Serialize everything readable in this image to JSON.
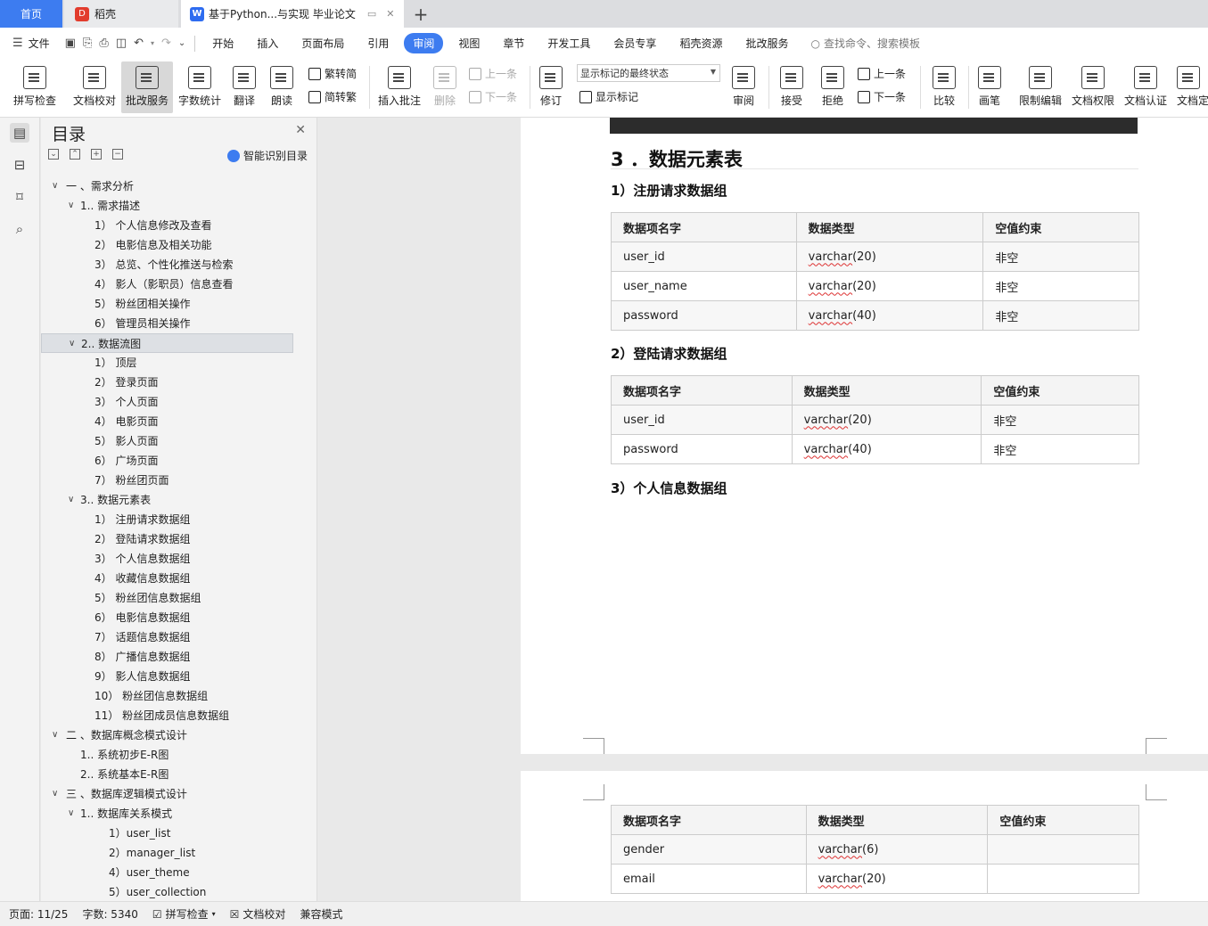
{
  "tabs": {
    "home": "首页",
    "daoke": "稻壳",
    "doc": "基于Python...与实现 毕业论文",
    "add": "+"
  },
  "menu": {
    "file": "文件",
    "items": [
      "开始",
      "插入",
      "页面布局",
      "引用",
      "审阅",
      "视图",
      "章节",
      "开发工具",
      "会员专享",
      "稻壳资源",
      "批改服务"
    ],
    "active": "审阅",
    "search": "查找命令、搜索模板"
  },
  "ribbon": {
    "spell": "拼写检查",
    "proofread": "文档校对",
    "correction": "批改服务",
    "wordcount": "字数统计",
    "translate": "翻译",
    "read": "朗读",
    "to_trad": "繁转简",
    "to_simp": "简转繁",
    "insert_comment": "插入批注",
    "delete": "删除",
    "prev": "上一条",
    "next": "下一条",
    "track": "修订",
    "markup_state": "显示标记的最终状态",
    "show_markup": "显示标记",
    "review": "审阅",
    "accept": "接受",
    "reject": "拒绝",
    "prev2": "上一条",
    "next2": "下一条",
    "compare": "比较",
    "pen": "画笔",
    "restrict": "限制编辑",
    "permission": "文档权限",
    "certify": "文档认证",
    "finalize": "文档定"
  },
  "toc": {
    "title": "目录",
    "smart": "智能识别目录",
    "items": [
      {
        "text": "一 、需求分析",
        "level": 0,
        "chev": true
      },
      {
        "text": "1.. 需求描述",
        "level": 1,
        "chev": true
      },
      {
        "text": "1） 个人信息修改及查看",
        "level": 2
      },
      {
        "text": "2） 电影信息及相关功能",
        "level": 2
      },
      {
        "text": "3） 总览、个性化推送与检索",
        "level": 2
      },
      {
        "text": "4） 影人（影职员）信息查看",
        "level": 2
      },
      {
        "text": "5） 粉丝团相关操作",
        "level": 2
      },
      {
        "text": "6） 管理员相关操作",
        "level": 2
      },
      {
        "text": "2.. 数据流图",
        "level": 1,
        "chev": true,
        "selected": true
      },
      {
        "text": "1） 顶层",
        "level": 2
      },
      {
        "text": "2） 登录页面",
        "level": 2
      },
      {
        "text": "3） 个人页面",
        "level": 2
      },
      {
        "text": "4） 电影页面",
        "level": 2
      },
      {
        "text": "5） 影人页面",
        "level": 2
      },
      {
        "text": "6） 广场页面",
        "level": 2
      },
      {
        "text": "7） 粉丝团页面",
        "level": 2
      },
      {
        "text": "3.. 数据元素表",
        "level": 1,
        "chev": true
      },
      {
        "text": "1） 注册请求数据组",
        "level": 2
      },
      {
        "text": "2） 登陆请求数据组",
        "level": 2
      },
      {
        "text": "3） 个人信息数据组",
        "level": 2
      },
      {
        "text": "4） 收藏信息数据组",
        "level": 2
      },
      {
        "text": "5） 粉丝团信息数据组",
        "level": 2
      },
      {
        "text": "6） 电影信息数据组",
        "level": 2
      },
      {
        "text": "7） 话题信息数据组",
        "level": 2
      },
      {
        "text": "8） 广播信息数据组",
        "level": 2
      },
      {
        "text": "9） 影人信息数据组",
        "level": 2
      },
      {
        "text": "10） 粉丝团信息数据组",
        "level": 2
      },
      {
        "text": "11） 粉丝团成员信息数据组",
        "level": 2
      },
      {
        "text": "二 、数据库概念模式设计",
        "level": 0,
        "chev": true
      },
      {
        "text": "1.. 系统初步E-R图",
        "level": 1
      },
      {
        "text": "2.. 系统基本E-R图",
        "level": 1
      },
      {
        "text": "三 、数据库逻辑模式设计",
        "level": 0,
        "chev": true
      },
      {
        "text": "1.. 数据库关系模式",
        "level": 1,
        "chev": true
      },
      {
        "text": "1）user_list",
        "level": 3
      },
      {
        "text": "2）manager_list",
        "level": 3
      },
      {
        "text": "4）user_theme",
        "level": 3
      },
      {
        "text": "5）user_collection",
        "level": 3
      }
    ]
  },
  "doc": {
    "section_title": "3 ．数据元素表",
    "sub1": "1）注册请求数据组",
    "sub2": "2）登陆请求数据组",
    "sub3": "3）个人信息数据组",
    "headers": [
      "数据项名字",
      "数据类型",
      "空值约束"
    ],
    "table1": [
      [
        "user_id",
        "varchar",
        "(20)",
        "非空"
      ],
      [
        "user_name",
        "varchar",
        "(20)",
        "非空"
      ],
      [
        "password",
        "varchar",
        "(40)",
        "非空"
      ]
    ],
    "table2": [
      [
        "user_id",
        "varchar",
        "(20)",
        "非空"
      ],
      [
        "password",
        "varchar",
        "(40)",
        "非空"
      ]
    ],
    "table3": [
      [
        "gender",
        "varchar",
        "(6)",
        ""
      ],
      [
        "email",
        "varchar",
        "(20)",
        ""
      ]
    ]
  },
  "status": {
    "page": "页面: 11/25",
    "words": "字数: 5340",
    "spell": "拼写检查",
    "proof": "文档校对",
    "compat": "兼容模式"
  },
  "colors": {
    "accent": "#3d7cf0",
    "logo_red": "#e23c2d"
  }
}
